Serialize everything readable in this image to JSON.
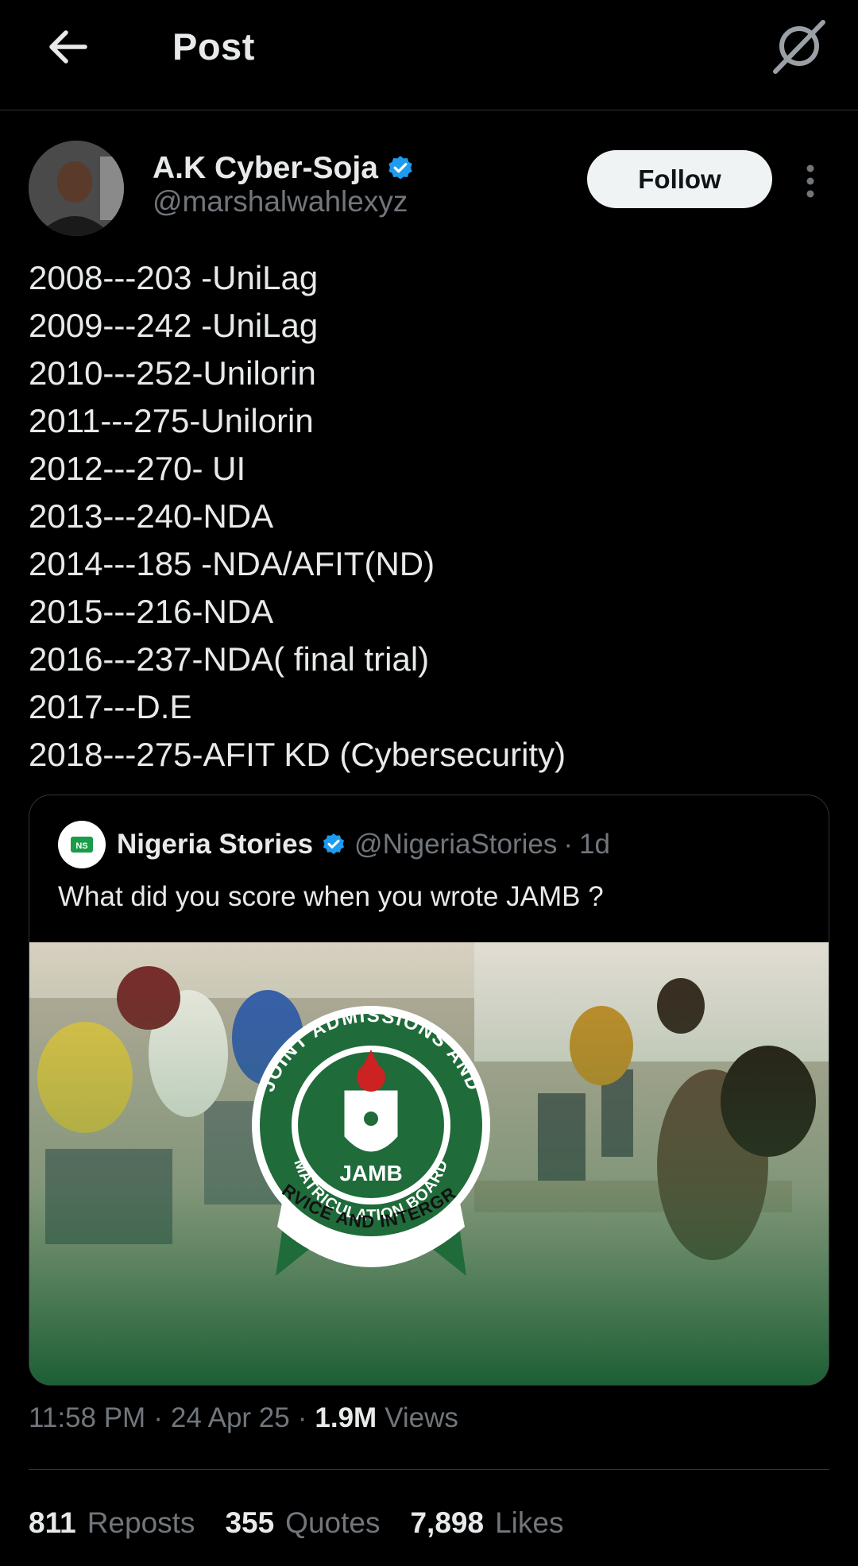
{
  "header": {
    "title": "Post",
    "back_icon": "arrow-left-icon",
    "grok_icon": "grok-icon"
  },
  "author": {
    "name": "A.K Cyber-Soja",
    "handle": "@marshalwahlexyz",
    "verified": true,
    "follow_label": "Follow",
    "more_icon": "more-vertical-icon"
  },
  "post": {
    "lines": [
      "2008---203 -UniLag",
      "2009---242 -UniLag",
      "2010---252-Unilorin",
      "2011---275-Unilorin",
      "2012---270- UI",
      "2013---240-NDA",
      "2014---185 -NDA/AFIT(ND)",
      "2015---216-NDA",
      "2016---237-NDA( final trial)",
      "2017---D.E",
      "2018---275-AFIT KD (Cybersecurity)"
    ]
  },
  "quote": {
    "name": "Nigeria Stories",
    "handle": "@NigeriaStories",
    "dot": "·",
    "time": "1d",
    "text": "What did you score when you wrote JAMB ?",
    "image": {
      "logo_top_text": "JOINT ADMISSIONS AND",
      "logo_center_text": "JAMB",
      "logo_ring_text": "MATRICULATION BOARD",
      "logo_ribbon_text": "SERVICE AND INTERGRITY"
    }
  },
  "meta": {
    "time": "11:58 PM",
    "date": "24 Apr 25",
    "views_count": "1.9M",
    "views_label": "Views",
    "sep": "·"
  },
  "stats": {
    "reposts_count": "811",
    "reposts_label": "Reposts",
    "quotes_count": "355",
    "quotes_label": "Quotes",
    "likes_count": "7,898",
    "likes_label": "Likes"
  },
  "colors": {
    "background": "#000000",
    "text": "#e7e9ea",
    "muted": "#71767b",
    "verified": "#1d9bf0",
    "jamb_green": "#1f6b3a"
  }
}
